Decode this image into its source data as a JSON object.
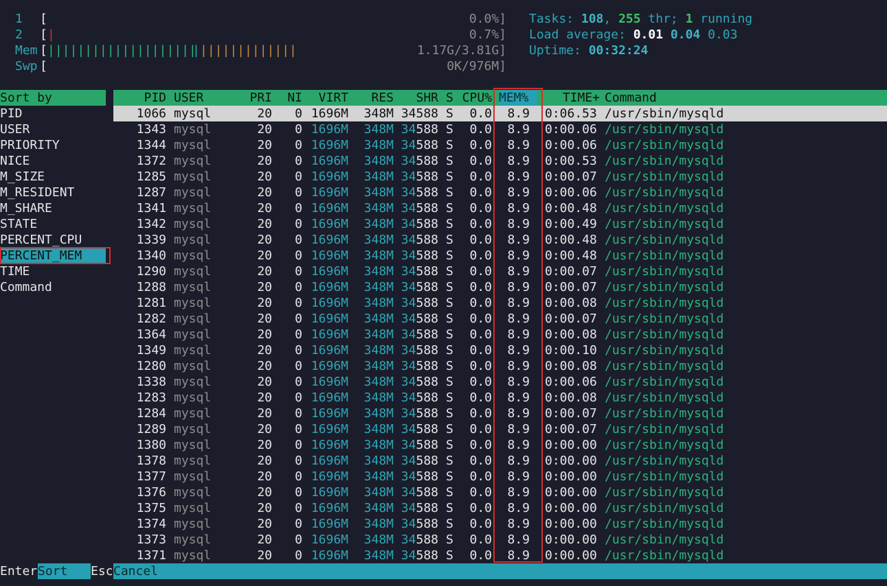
{
  "meters": {
    "cpu1": {
      "label": "1",
      "value": "0.0%]",
      "bar": ""
    },
    "cpu2": {
      "label": "2",
      "value": "0.7%]",
      "bar": "|"
    },
    "mem": {
      "label": "Mem",
      "value": "1.17G/3.81G]",
      "bar_green": "||||||||||||||||||||",
      "bar_blue": "|",
      "bar_orange": "|||||||||||||"
    },
    "swp": {
      "label": "Swp",
      "value": "0K/976M]",
      "bar": ""
    }
  },
  "summary": {
    "tasks_label": "Tasks: ",
    "tasks": "108",
    "thr_sep": ", ",
    "threads": "255",
    "thr_label": " thr; ",
    "running": "1",
    "running_label": " running",
    "load_label": "Load average: ",
    "load1": "0.01",
    "load5": "0.04",
    "load15": "0.03",
    "uptime_label": "Uptime: ",
    "uptime": "00:32:24"
  },
  "sort_panel": {
    "header": "Sort by",
    "items": [
      "PID",
      "USER",
      "PRIORITY",
      "NICE",
      "M_SIZE",
      "M_RESIDENT",
      "M_SHARE",
      "STATE",
      "PERCENT_CPU",
      "PERCENT_MEM",
      "TIME",
      "Command"
    ],
    "selected_index": 9
  },
  "table": {
    "columns": [
      "PID",
      "USER",
      "PRI",
      "NI",
      "VIRT",
      "RES",
      "SHR",
      "S",
      "CPU%",
      "MEM%",
      "TIME+",
      "Command"
    ],
    "rows": [
      [
        "1066",
        "mysql",
        "20",
        "0",
        "1696M",
        "348M",
        "34588",
        "S",
        "0.0",
        "8.9",
        "0:06.53",
        "/usr/sbin/mysqld"
      ],
      [
        "1343",
        "mysql",
        "20",
        "0",
        "1696M",
        "348M",
        "34588",
        "S",
        "0.0",
        "8.9",
        "0:00.06",
        "/usr/sbin/mysqld"
      ],
      [
        "1344",
        "mysql",
        "20",
        "0",
        "1696M",
        "348M",
        "34588",
        "S",
        "0.0",
        "8.9",
        "0:00.06",
        "/usr/sbin/mysqld"
      ],
      [
        "1372",
        "mysql",
        "20",
        "0",
        "1696M",
        "348M",
        "34588",
        "S",
        "0.0",
        "8.9",
        "0:00.53",
        "/usr/sbin/mysqld"
      ],
      [
        "1285",
        "mysql",
        "20",
        "0",
        "1696M",
        "348M",
        "34588",
        "S",
        "0.0",
        "8.9",
        "0:00.07",
        "/usr/sbin/mysqld"
      ],
      [
        "1287",
        "mysql",
        "20",
        "0",
        "1696M",
        "348M",
        "34588",
        "S",
        "0.0",
        "8.9",
        "0:00.06",
        "/usr/sbin/mysqld"
      ],
      [
        "1341",
        "mysql",
        "20",
        "0",
        "1696M",
        "348M",
        "34588",
        "S",
        "0.0",
        "8.9",
        "0:00.48",
        "/usr/sbin/mysqld"
      ],
      [
        "1342",
        "mysql",
        "20",
        "0",
        "1696M",
        "348M",
        "34588",
        "S",
        "0.0",
        "8.9",
        "0:00.49",
        "/usr/sbin/mysqld"
      ],
      [
        "1339",
        "mysql",
        "20",
        "0",
        "1696M",
        "348M",
        "34588",
        "S",
        "0.0",
        "8.9",
        "0:00.48",
        "/usr/sbin/mysqld"
      ],
      [
        "1340",
        "mysql",
        "20",
        "0",
        "1696M",
        "348M",
        "34588",
        "S",
        "0.0",
        "8.9",
        "0:00.48",
        "/usr/sbin/mysqld"
      ],
      [
        "1290",
        "mysql",
        "20",
        "0",
        "1696M",
        "348M",
        "34588",
        "S",
        "0.0",
        "8.9",
        "0:00.07",
        "/usr/sbin/mysqld"
      ],
      [
        "1288",
        "mysql",
        "20",
        "0",
        "1696M",
        "348M",
        "34588",
        "S",
        "0.0",
        "8.9",
        "0:00.07",
        "/usr/sbin/mysqld"
      ],
      [
        "1281",
        "mysql",
        "20",
        "0",
        "1696M",
        "348M",
        "34588",
        "S",
        "0.0",
        "8.9",
        "0:00.08",
        "/usr/sbin/mysqld"
      ],
      [
        "1282",
        "mysql",
        "20",
        "0",
        "1696M",
        "348M",
        "34588",
        "S",
        "0.0",
        "8.9",
        "0:00.07",
        "/usr/sbin/mysqld"
      ],
      [
        "1364",
        "mysql",
        "20",
        "0",
        "1696M",
        "348M",
        "34588",
        "S",
        "0.0",
        "8.9",
        "0:00.08",
        "/usr/sbin/mysqld"
      ],
      [
        "1349",
        "mysql",
        "20",
        "0",
        "1696M",
        "348M",
        "34588",
        "S",
        "0.0",
        "8.9",
        "0:00.10",
        "/usr/sbin/mysqld"
      ],
      [
        "1280",
        "mysql",
        "20",
        "0",
        "1696M",
        "348M",
        "34588",
        "S",
        "0.0",
        "8.9",
        "0:00.08",
        "/usr/sbin/mysqld"
      ],
      [
        "1338",
        "mysql",
        "20",
        "0",
        "1696M",
        "348M",
        "34588",
        "S",
        "0.0",
        "8.9",
        "0:00.06",
        "/usr/sbin/mysqld"
      ],
      [
        "1283",
        "mysql",
        "20",
        "0",
        "1696M",
        "348M",
        "34588",
        "S",
        "0.0",
        "8.9",
        "0:00.08",
        "/usr/sbin/mysqld"
      ],
      [
        "1284",
        "mysql",
        "20",
        "0",
        "1696M",
        "348M",
        "34588",
        "S",
        "0.0",
        "8.9",
        "0:00.07",
        "/usr/sbin/mysqld"
      ],
      [
        "1289",
        "mysql",
        "20",
        "0",
        "1696M",
        "348M",
        "34588",
        "S",
        "0.0",
        "8.9",
        "0:00.07",
        "/usr/sbin/mysqld"
      ],
      [
        "1380",
        "mysql",
        "20",
        "0",
        "1696M",
        "348M",
        "34588",
        "S",
        "0.0",
        "8.9",
        "0:00.00",
        "/usr/sbin/mysqld"
      ],
      [
        "1378",
        "mysql",
        "20",
        "0",
        "1696M",
        "348M",
        "34588",
        "S",
        "0.0",
        "8.9",
        "0:00.00",
        "/usr/sbin/mysqld"
      ],
      [
        "1377",
        "mysql",
        "20",
        "0",
        "1696M",
        "348M",
        "34588",
        "S",
        "0.0",
        "8.9",
        "0:00.00",
        "/usr/sbin/mysqld"
      ],
      [
        "1376",
        "mysql",
        "20",
        "0",
        "1696M",
        "348M",
        "34588",
        "S",
        "0.0",
        "8.9",
        "0:00.00",
        "/usr/sbin/mysqld"
      ],
      [
        "1375",
        "mysql",
        "20",
        "0",
        "1696M",
        "348M",
        "34588",
        "S",
        "0.0",
        "8.9",
        "0:00.00",
        "/usr/sbin/mysqld"
      ],
      [
        "1374",
        "mysql",
        "20",
        "0",
        "1696M",
        "348M",
        "34588",
        "S",
        "0.0",
        "8.9",
        "0:00.00",
        "/usr/sbin/mysqld"
      ],
      [
        "1373",
        "mysql",
        "20",
        "0",
        "1696M",
        "348M",
        "34588",
        "S",
        "0.0",
        "8.9",
        "0:00.00",
        "/usr/sbin/mysqld"
      ],
      [
        "1371",
        "mysql",
        "20",
        "0",
        "1696M",
        "348M",
        "34588",
        "S",
        "0.0",
        "8.9",
        "0:00.00",
        "/usr/sbin/mysqld"
      ]
    ]
  },
  "footer": {
    "enter_key": "Enter",
    "enter_label": "Sort",
    "esc_key": "Esc",
    "esc_label": "Cancel"
  },
  "colors": {
    "background": "#1b1d2b",
    "header_green": "#2ba66a",
    "accent_cyan": "#26a0b2",
    "highlight_red": "#d82a30"
  }
}
